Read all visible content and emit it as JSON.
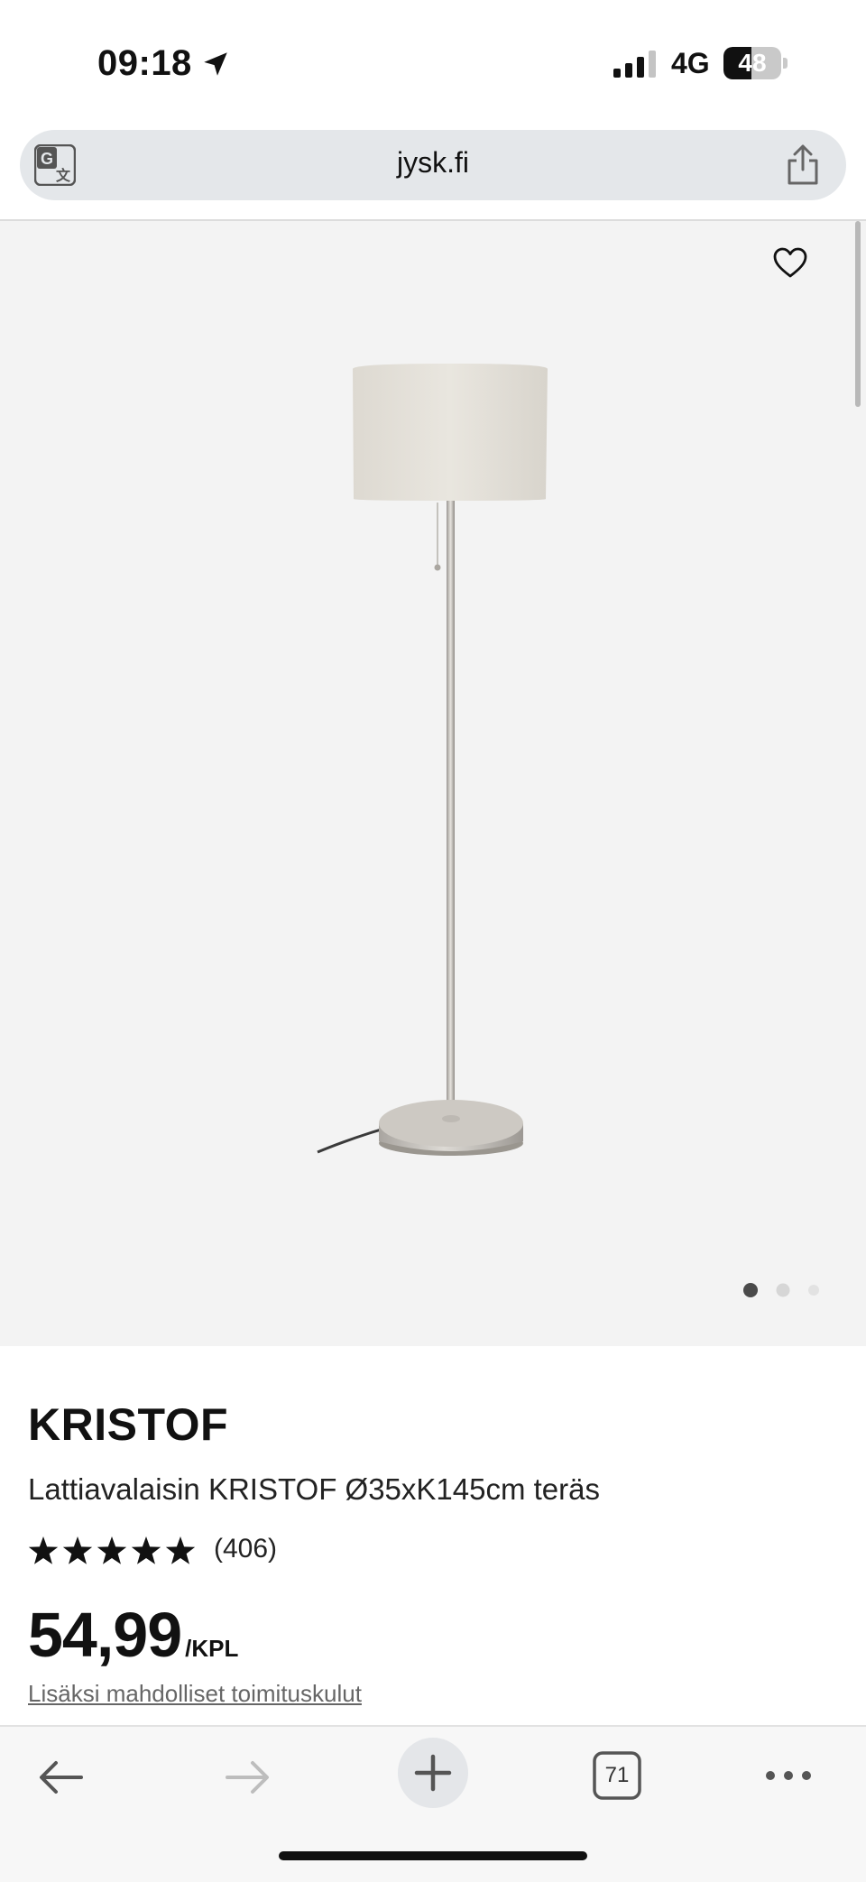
{
  "status_bar": {
    "time": "09:18",
    "network": "4G",
    "battery_level": "48",
    "battery_fraction": 0.48
  },
  "address_bar": {
    "url": "jysk.fi",
    "translate_icon": "translate-icon",
    "share_icon": "share-icon"
  },
  "gallery": {
    "favorite_icon": "heart-icon",
    "image_count": 3,
    "active_index": 0
  },
  "product": {
    "brand": "KRISTOF",
    "description": "Lattiavalaisin KRISTOF Ø35xK145cm teräs",
    "rating_stars": 5,
    "rating_count": "(406)",
    "price": "54,99",
    "price_unit": "/KPL",
    "shipping_note": "Lisäksi mahdolliset toimituskulut"
  },
  "toolbar": {
    "tabs_count": "71",
    "icons": [
      "back-arrow-icon",
      "forward-arrow-icon",
      "plus-icon",
      "tabs-icon",
      "more-icon"
    ]
  },
  "colors": {
    "gallery_bg": "#f3f3f3",
    "text": "#111111",
    "link": "#666666"
  }
}
